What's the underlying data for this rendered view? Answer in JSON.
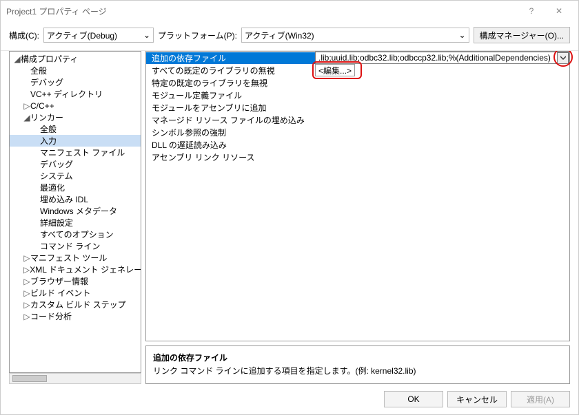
{
  "title": "Project1 プロパティ ページ",
  "toolbar": {
    "config_label": "構成(C):",
    "config_value": "アクティブ(Debug)",
    "platform_label": "プラットフォーム(P):",
    "platform_value": "アクティブ(Win32)",
    "config_manager": "構成マネージャー(O)..."
  },
  "tree": [
    {
      "ind": 0,
      "exp": "◢",
      "label": "構成プロパティ"
    },
    {
      "ind": 1,
      "exp": "",
      "label": "全般"
    },
    {
      "ind": 1,
      "exp": "",
      "label": "デバッグ"
    },
    {
      "ind": 1,
      "exp": "",
      "label": "VC++ ディレクトリ"
    },
    {
      "ind": 1,
      "exp": "▷",
      "label": "C/C++"
    },
    {
      "ind": 1,
      "exp": "◢",
      "label": "リンカー"
    },
    {
      "ind": 2,
      "exp": "",
      "label": "全般"
    },
    {
      "ind": 2,
      "exp": "",
      "label": "入力",
      "selected": true
    },
    {
      "ind": 2,
      "exp": "",
      "label": "マニフェスト ファイル"
    },
    {
      "ind": 2,
      "exp": "",
      "label": "デバッグ"
    },
    {
      "ind": 2,
      "exp": "",
      "label": "システム"
    },
    {
      "ind": 2,
      "exp": "",
      "label": "最適化"
    },
    {
      "ind": 2,
      "exp": "",
      "label": "埋め込み IDL"
    },
    {
      "ind": 2,
      "exp": "",
      "label": "Windows メタデータ"
    },
    {
      "ind": 2,
      "exp": "",
      "label": "詳細設定"
    },
    {
      "ind": 2,
      "exp": "",
      "label": "すべてのオプション"
    },
    {
      "ind": 2,
      "exp": "",
      "label": "コマンド ライン"
    },
    {
      "ind": 1,
      "exp": "▷",
      "label": "マニフェスト ツール"
    },
    {
      "ind": 1,
      "exp": "▷",
      "label": "XML ドキュメント ジェネレーター"
    },
    {
      "ind": 1,
      "exp": "▷",
      "label": "ブラウザー情報"
    },
    {
      "ind": 1,
      "exp": "▷",
      "label": "ビルド イベント"
    },
    {
      "ind": 1,
      "exp": "▷",
      "label": "カスタム ビルド ステップ"
    },
    {
      "ind": 1,
      "exp": "▷",
      "label": "コード分析"
    }
  ],
  "grid": [
    {
      "label": "追加の依存ファイル",
      "value": ".lib;uuid.lib;odbc32.lib;odbccp32.lib;%(AdditionalDependencies)",
      "selected": true
    },
    {
      "label": "すべての既定のライブラリの無視",
      "value": ""
    },
    {
      "label": "特定の既定のライブラリを無視",
      "value": ""
    },
    {
      "label": "モジュール定義ファイル",
      "value": ""
    },
    {
      "label": "モジュールをアセンブリに追加",
      "value": ""
    },
    {
      "label": "マネージド リソース ファイルの埋め込み",
      "value": ""
    },
    {
      "label": "シンボル参照の強制",
      "value": ""
    },
    {
      "label": "DLL の遅延読み込み",
      "value": ""
    },
    {
      "label": "アセンブリ リンク リソース",
      "value": ""
    }
  ],
  "edit_popup": "<編集...>",
  "desc": {
    "title": "追加の依存ファイル",
    "text": "リンク コマンド ラインに追加する項目を指定します。(例: kernel32.lib)"
  },
  "buttons": {
    "ok": "OK",
    "cancel": "キャンセル",
    "apply": "適用(A)"
  }
}
